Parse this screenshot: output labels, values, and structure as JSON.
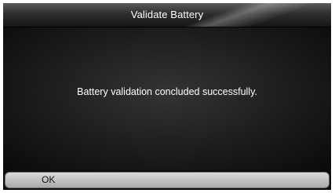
{
  "header": {
    "title": "Validate Battery"
  },
  "main": {
    "message": "Battery validation concluded successfully."
  },
  "footer": {
    "ok_label": "OK"
  }
}
